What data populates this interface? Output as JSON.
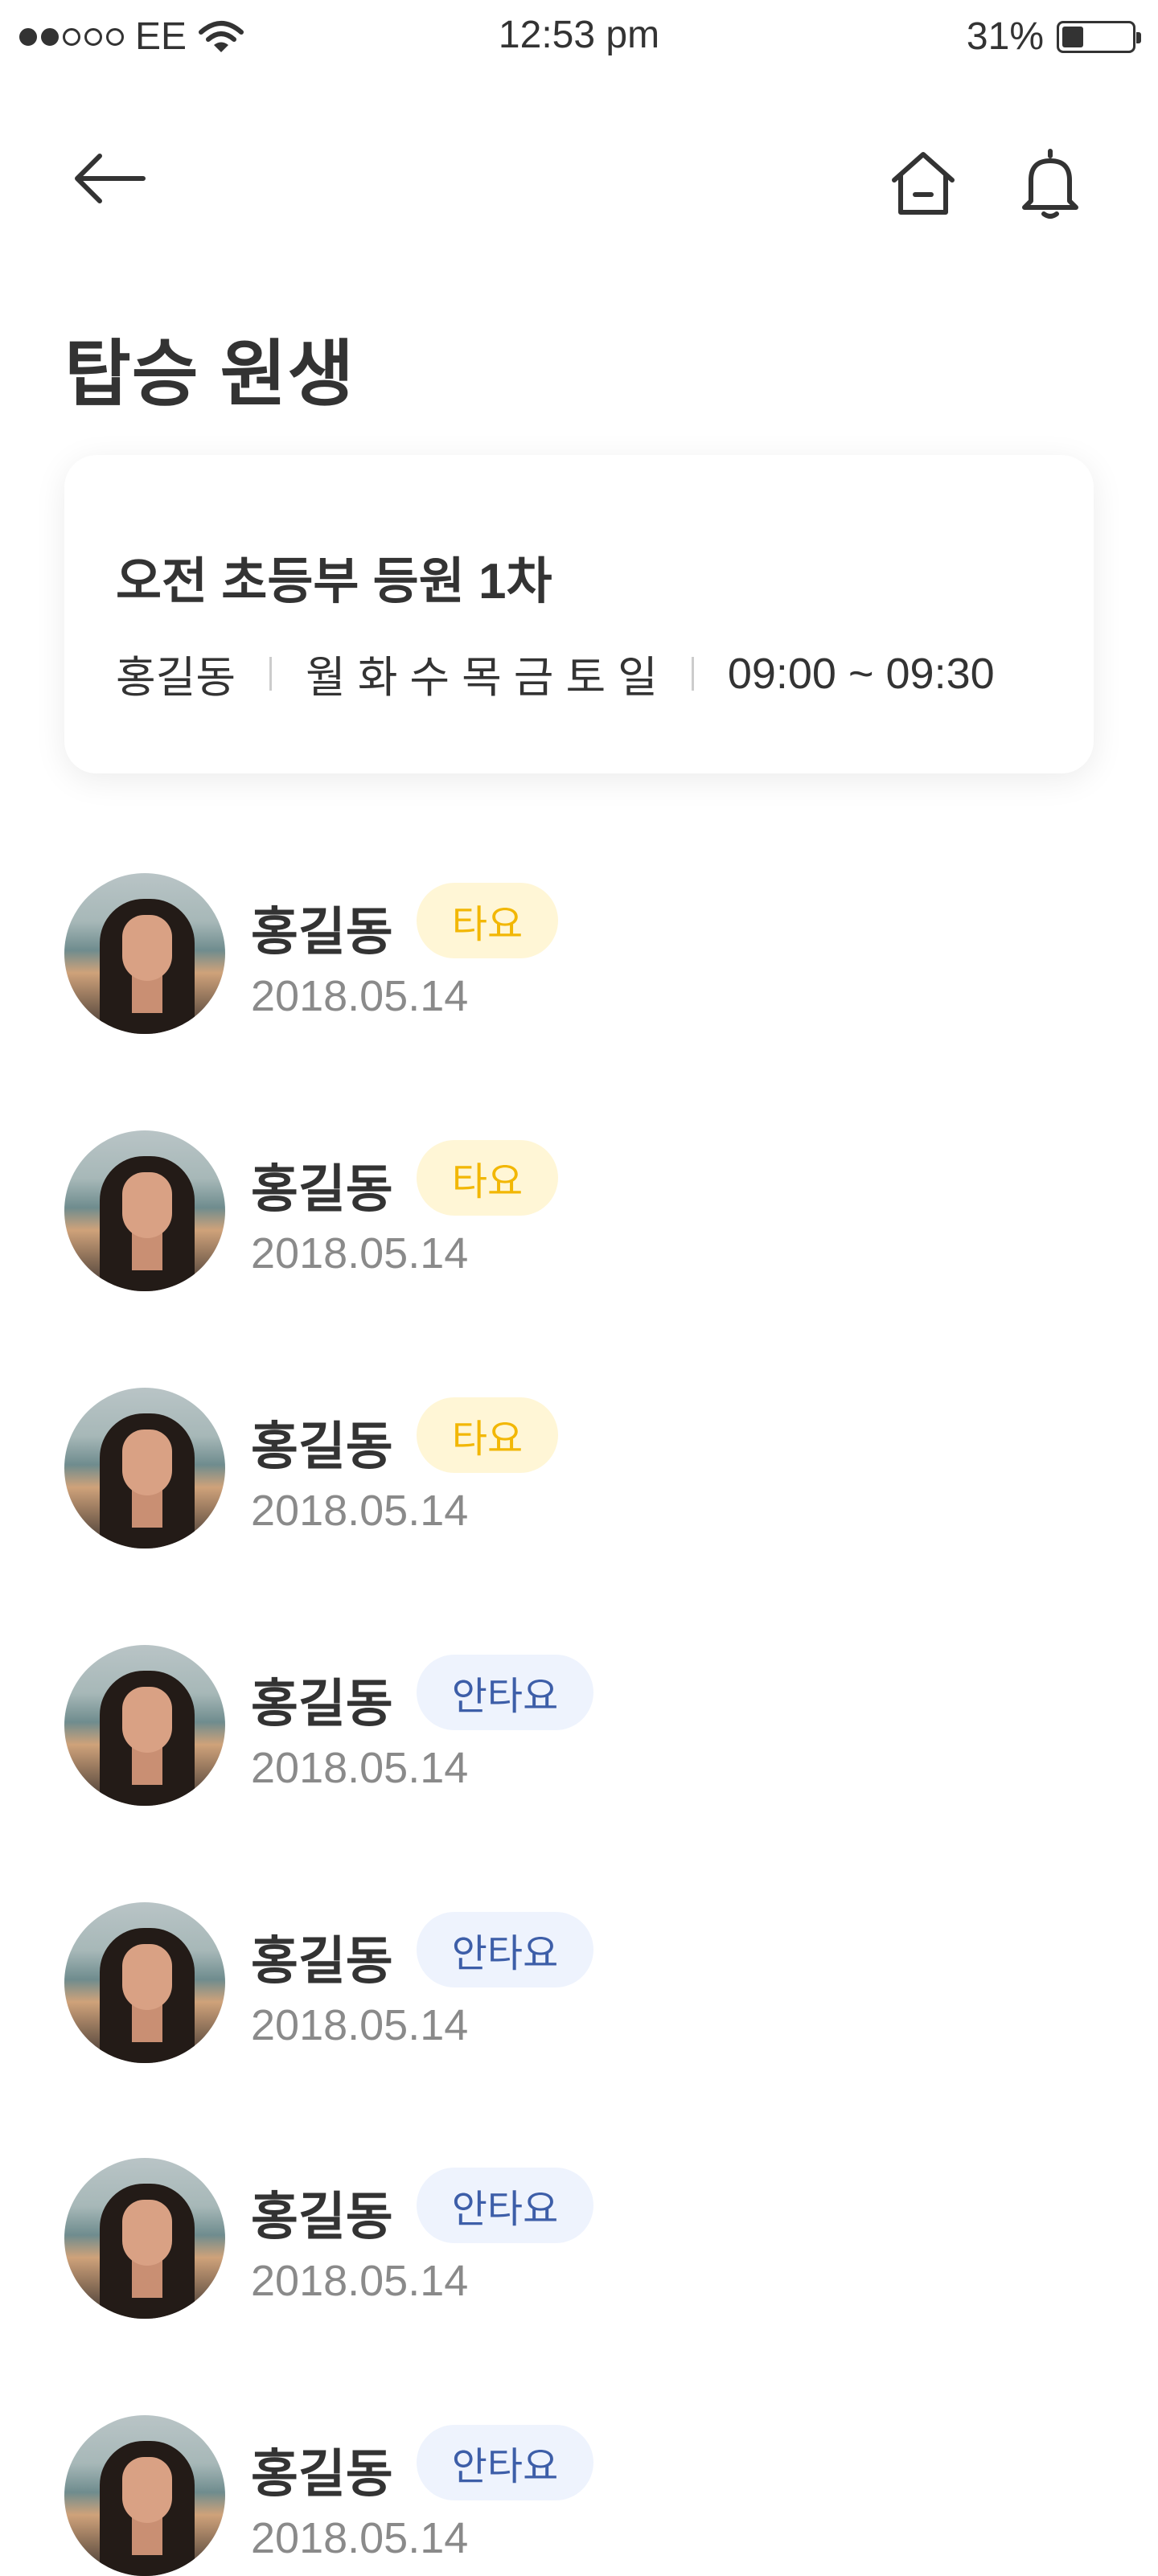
{
  "status_bar": {
    "carrier": "EE",
    "time": "12:53 pm",
    "battery_percent": "31%",
    "battery_level": 0.31,
    "signal_bars_filled": 2,
    "signal_bars_total": 5
  },
  "nav": {
    "back_icon": "arrow-left-icon",
    "home_icon": "home-icon",
    "bell_icon": "bell-icon"
  },
  "page": {
    "title": "탑승 원생"
  },
  "route": {
    "title": "오전 초등부 등원 1차",
    "driver": "홍길동",
    "days": "월 화 수 목 금 토 일",
    "time": "09:00 ~ 09:30"
  },
  "students": [
    {
      "name": "홍길동",
      "status": "타요",
      "status_type": "ride",
      "date": "2018.05.14"
    },
    {
      "name": "홍길동",
      "status": "타요",
      "status_type": "ride",
      "date": "2018.05.14"
    },
    {
      "name": "홍길동",
      "status": "타요",
      "status_type": "ride",
      "date": "2018.05.14"
    },
    {
      "name": "홍길동",
      "status": "안타요",
      "status_type": "noride",
      "date": "2018.05.14"
    },
    {
      "name": "홍길동",
      "status": "안타요",
      "status_type": "noride",
      "date": "2018.05.14"
    },
    {
      "name": "홍길동",
      "status": "안타요",
      "status_type": "noride",
      "date": "2018.05.14"
    },
    {
      "name": "홍길동",
      "status": "안타요",
      "status_type": "noride",
      "date": "2018.05.14"
    }
  ],
  "colors": {
    "ride_badge_bg": "#fff6d6",
    "ride_badge_text": "#f2b705",
    "noride_badge_bg": "#eef3fd",
    "noride_badge_text": "#3d5ea8"
  }
}
